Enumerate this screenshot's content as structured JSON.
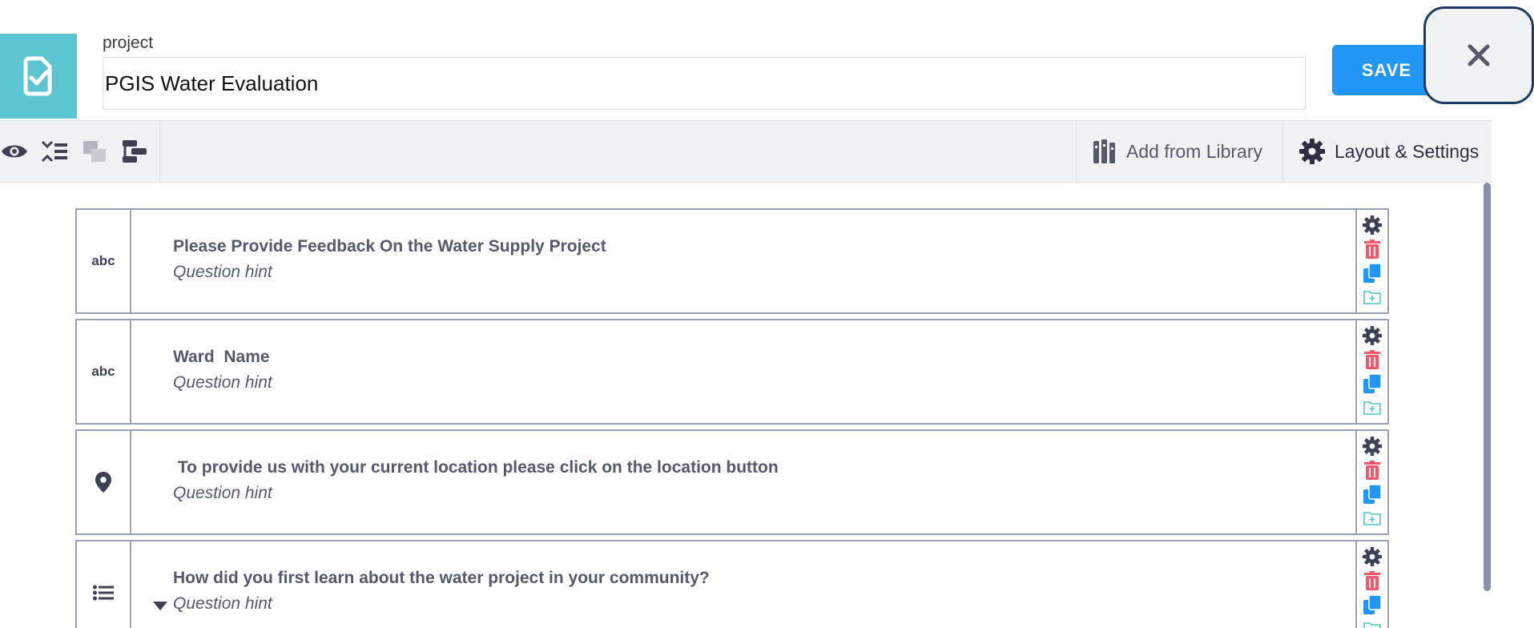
{
  "header": {
    "project_label": "project",
    "project_name": "PGIS Water Evaluation",
    "save_label": "SAVE"
  },
  "toolbar": {
    "add_from_library": "Add from Library",
    "layout_settings": "Layout & Settings"
  },
  "questions": [
    {
      "type": "text",
      "type_label": "abc",
      "label": "Please Provide Feedback On the Water Supply Project",
      "hint": "Question hint"
    },
    {
      "type": "text",
      "type_label": "abc",
      "label": "Ward  Name",
      "hint": "Question hint"
    },
    {
      "type": "geopoint",
      "type_label": "",
      "label": " To provide us with your current location please click on the location button",
      "hint": "Question hint"
    },
    {
      "type": "select",
      "type_label": "",
      "label": "How did you first learn about the water project in your community?",
      "hint": "Question hint"
    }
  ],
  "colors": {
    "accent": "#2196f3",
    "logo_bg": "#5bc6cf",
    "delete": "#f05a6b",
    "duplicate": "#2196f3",
    "add_to_library": "#4fc6c6",
    "settings": "#3d4152"
  },
  "icons": {
    "logo": "checklist-icon",
    "close": "close-icon",
    "preview": "eye-icon",
    "question_list": "collapse-list-icon",
    "group": "copy-stack-icon",
    "skip_logic": "branch-icon",
    "library": "library-icon",
    "settings": "gear-icon"
  }
}
